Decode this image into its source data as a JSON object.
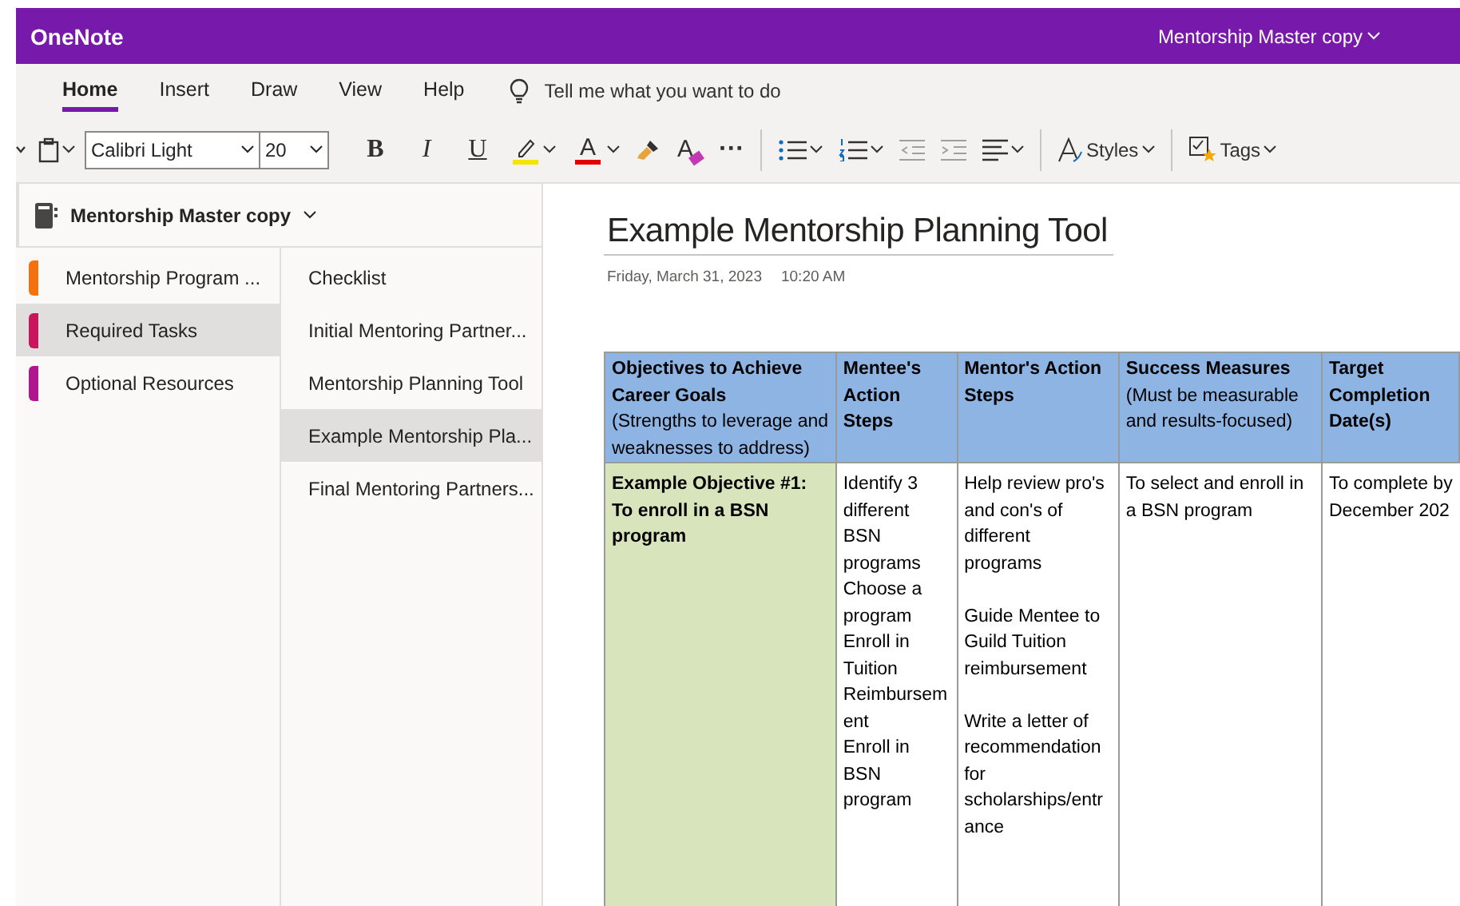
{
  "header": {
    "app_name": "OneNote",
    "notebook_menu": "Mentorship Master copy"
  },
  "tabs": [
    {
      "label": "Home",
      "selected": true
    },
    {
      "label": "Insert",
      "selected": false
    },
    {
      "label": "Draw",
      "selected": false
    },
    {
      "label": "View",
      "selected": false
    },
    {
      "label": "Help",
      "selected": false
    }
  ],
  "tell_me": {
    "placeholder": "Tell me what you want to do"
  },
  "toolbar": {
    "font": "Calibri Light",
    "size": "20",
    "bold": "B",
    "italic": "I",
    "underline": "U",
    "highlight": {
      "color": "#f5e400"
    },
    "font_color": {
      "glyph": "A",
      "color": "#e00000"
    },
    "clear_format": "A",
    "more": "···",
    "styles": "Styles",
    "tags": "Tags"
  },
  "sidebar": {
    "notebook": "Mentorship Master copy",
    "sections": [
      {
        "name": "Mentorship Program ...",
        "color": "#f3720f",
        "selected": false
      },
      {
        "name": "Required Tasks",
        "color": "#c8155b",
        "selected": true
      },
      {
        "name": "Optional Resources",
        "color": "#b0178f",
        "selected": false
      }
    ],
    "pages": [
      {
        "title": "Checklist",
        "selected": false
      },
      {
        "title": "Initial Mentoring Partner...",
        "selected": false
      },
      {
        "title": "Mentorship Planning Tool",
        "selected": false
      },
      {
        "title": "Example Mentorship Pla...",
        "selected": true
      },
      {
        "title": "Final Mentoring Partners...",
        "selected": false
      }
    ]
  },
  "page": {
    "title": "Example Mentorship Planning Tool",
    "date": "Friday, March 31, 2023",
    "time": "10:20 AM",
    "table": {
      "columns": [
        {
          "heading": "Objectives to Achieve Career Goals",
          "note": "(Strengths to leverage and weaknesses to address)"
        },
        {
          "heading": "Mentee's Action Steps"
        },
        {
          "heading": "Mentor's Action Steps"
        },
        {
          "heading": "Success Measures",
          "note": "(Must be measurable and results-focused)"
        },
        {
          "heading": "Target Completion Date(s)"
        }
      ],
      "rows": [
        {
          "cells": [
            [
              "Example Objective #1: To enroll in a BSN program"
            ],
            [
              "Identify 3 different BSN programs",
              "Choose a program",
              "Enroll in Tuition Reimbursement",
              "Enroll in BSN program"
            ],
            [
              "Help review pro's and con's of different programs",
              "",
              "Guide Mentee to Guild Tuition reimbursement",
              "",
              "Write a letter of recommendation for scholarships/entrance"
            ],
            [
              "To select and enroll in a BSN program"
            ],
            [
              "To complete by",
              "December 202"
            ]
          ]
        }
      ]
    }
  }
}
